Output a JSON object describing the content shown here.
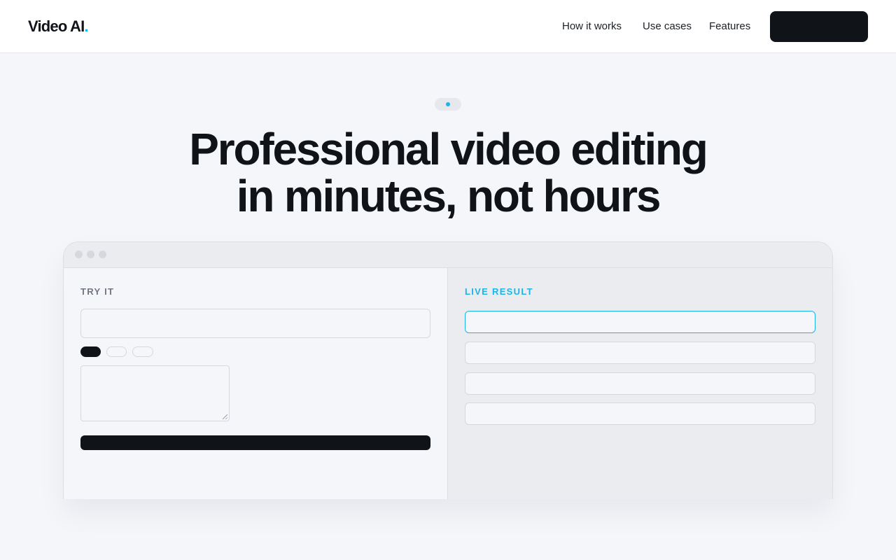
{
  "header": {
    "logo_text": "Video AI",
    "logo_dot": ".",
    "nav": [
      {
        "label": "How it works"
      },
      {
        "label": "Use cases"
      },
      {
        "label": "Features"
      }
    ],
    "cta_label": ""
  },
  "hero": {
    "badge_label": "",
    "headline_line1": "Professional video editing",
    "headline_line2": "in minutes, not hours"
  },
  "demo": {
    "left_label": "TRY IT",
    "right_label": "LIVE RESULT",
    "input_value": "",
    "textarea_value": "",
    "chips": [
      {
        "label": "",
        "state": "active"
      },
      {
        "label": "",
        "state": "inactive"
      },
      {
        "label": "",
        "state": "inactive"
      }
    ],
    "submit_label": "",
    "results": [
      {
        "text": "",
        "state": "highlighted"
      },
      {
        "text": "",
        "state": "default"
      },
      {
        "text": "",
        "state": "default"
      },
      {
        "text": "",
        "state": "default"
      }
    ]
  },
  "colors": {
    "accent": "#1ab6e6",
    "dark": "#101418",
    "background": "#f5f6fa"
  }
}
